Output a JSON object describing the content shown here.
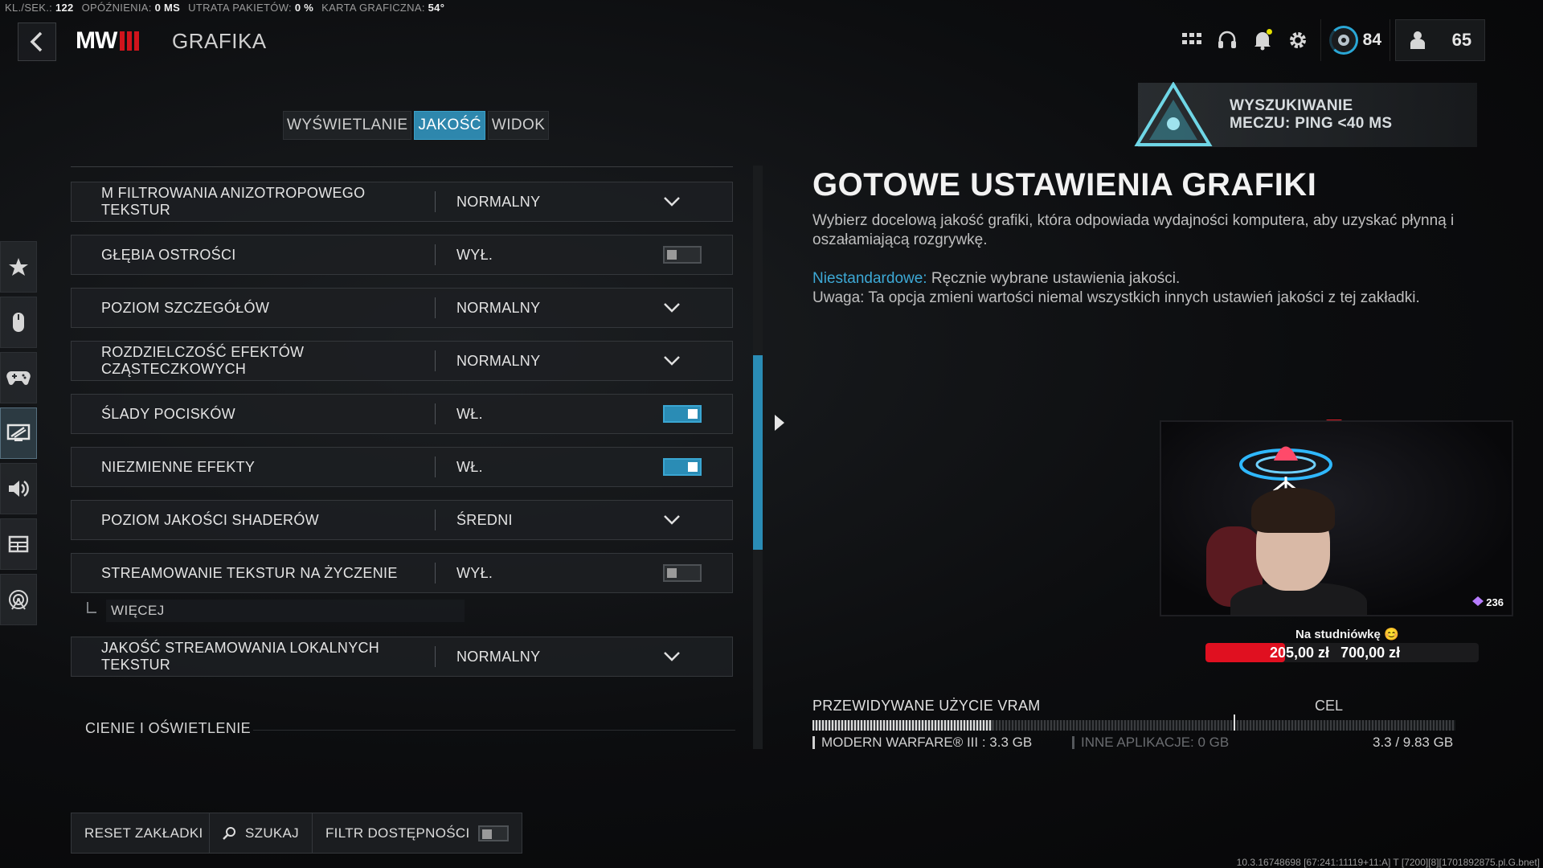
{
  "stats": [
    {
      "label": "KL./SEK.:",
      "value": "122"
    },
    {
      "label": "OPÓŹNIENIA:",
      "value": "0 MS"
    },
    {
      "label": "UTRATA PAKIETÓW:",
      "value": "0 %"
    },
    {
      "label": "KARTA GRAFICZNA:",
      "value": "54°"
    }
  ],
  "header": {
    "logo_text": "MW",
    "title": "GRAFIKA",
    "level": "84",
    "currency": "65"
  },
  "tabs": [
    {
      "label": "WYŚWIETLANIE",
      "active": false
    },
    {
      "label": "JAKOŚĆ",
      "active": true
    },
    {
      "label": "WIDOK",
      "active": false
    }
  ],
  "settings": [
    {
      "name": "M FILTROWANIA ANIZOTROPOWEGO TEKSTUR",
      "value": "NORMALNY",
      "control": "dropdown"
    },
    {
      "name": "GŁĘBIA OSTROŚCI",
      "value": "WYŁ.",
      "control": "toggle",
      "on": false
    },
    {
      "name": "POZIOM SZCZEGÓŁÓW",
      "value": "NORMALNY",
      "control": "dropdown"
    },
    {
      "name": "ROZDZIELCZOŚĆ EFEKTÓW CZĄSTECZKOWYCH",
      "value": "NORMALNY",
      "control": "dropdown"
    },
    {
      "name": "ŚLADY POCISKÓW",
      "value": "WŁ.",
      "control": "toggle",
      "on": true
    },
    {
      "name": "NIEZMIENNE EFEKTY",
      "value": "WŁ.",
      "control": "toggle",
      "on": true
    },
    {
      "name": "POZIOM JAKOŚCI SHADERÓW",
      "value": "ŚREDNI",
      "control": "dropdown"
    },
    {
      "name": "STREAMOWANIE TEKSTUR NA ŻYCZENIE",
      "value": "WYŁ.",
      "control": "toggle",
      "on": false
    },
    {
      "name": "JAKOŚĆ STREAMOWANIA LOKALNYCH TEKSTUR",
      "value": "NORMALNY",
      "control": "dropdown"
    }
  ],
  "more_label": "WIĘCEJ",
  "section_label": "CIENIE I OŚWIETLENIE",
  "bottom_buttons": {
    "reset": "RESET ZAKŁADKI",
    "search": "SZUKAJ",
    "filter": "FILTR DOSTĘPNOŚCI"
  },
  "match": {
    "line1": "WYSZUKIWANIE",
    "line2": "MECZU: PING <40 MS"
  },
  "panel": {
    "title": "GOTOWE USTAWIENIA GRAFIKI",
    "description": "Wybierz docelową jakość grafiki, która odpowiada wydajności komputera, aby uzyskać płynną i oszałamiającą rozgrywkę.",
    "custom_label": "Niestandardowe:",
    "custom_text": "Ręcznie wybrane ustawienia jakości.",
    "warning": "Uwaga: Ta opcja zmieni wartości niemal wszystkich innych ustawień jakości z tej zakładki."
  },
  "stream": {
    "viewer_count": "236",
    "goal_label": "Na studniówkę 😊",
    "goal_current": "205,00 zł",
    "goal_target": "700,00 zł",
    "goal_progress": 0.29
  },
  "vram": {
    "title": "PRZEWIDYWANE UŻYCIE VRAM",
    "target_label": "CEL",
    "mw_label": "MODERN WARFARE® III : 3.3 GB",
    "other_label": "INNE APLIKACJE: 0 GB",
    "total": "3.3 / 9.83 GB",
    "used_fraction": 0.28,
    "target_fraction": 0.655
  },
  "build_string": "10.3.16748698 [67:241:11119+11:A] T [7200][8][1701892875.pl.G.bnet]",
  "colors": {
    "accent": "#2a8cb5",
    "red": "#d0141c"
  }
}
